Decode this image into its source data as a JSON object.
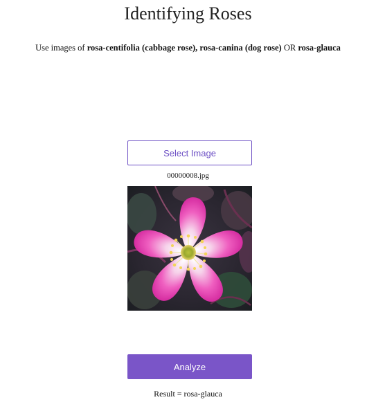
{
  "page": {
    "title": "Identifying Roses",
    "instructions": {
      "prefix": "Use images of ",
      "option1": "rosa-centifolia (cabbage rose)",
      "sep1": ", ",
      "option2": "rosa-canina (dog rose)",
      "sep2": " OR ",
      "option3": "rosa-glauca"
    }
  },
  "upload": {
    "select_label": "Select Image",
    "filename": "00000008.jpg",
    "preview_icon": "rose-flower-image"
  },
  "analysis": {
    "analyze_label": "Analyze",
    "result_text": "Result = rosa-glauca"
  },
  "colors": {
    "accent": "#7a55c8",
    "accent_border": "#6c4fc4"
  }
}
